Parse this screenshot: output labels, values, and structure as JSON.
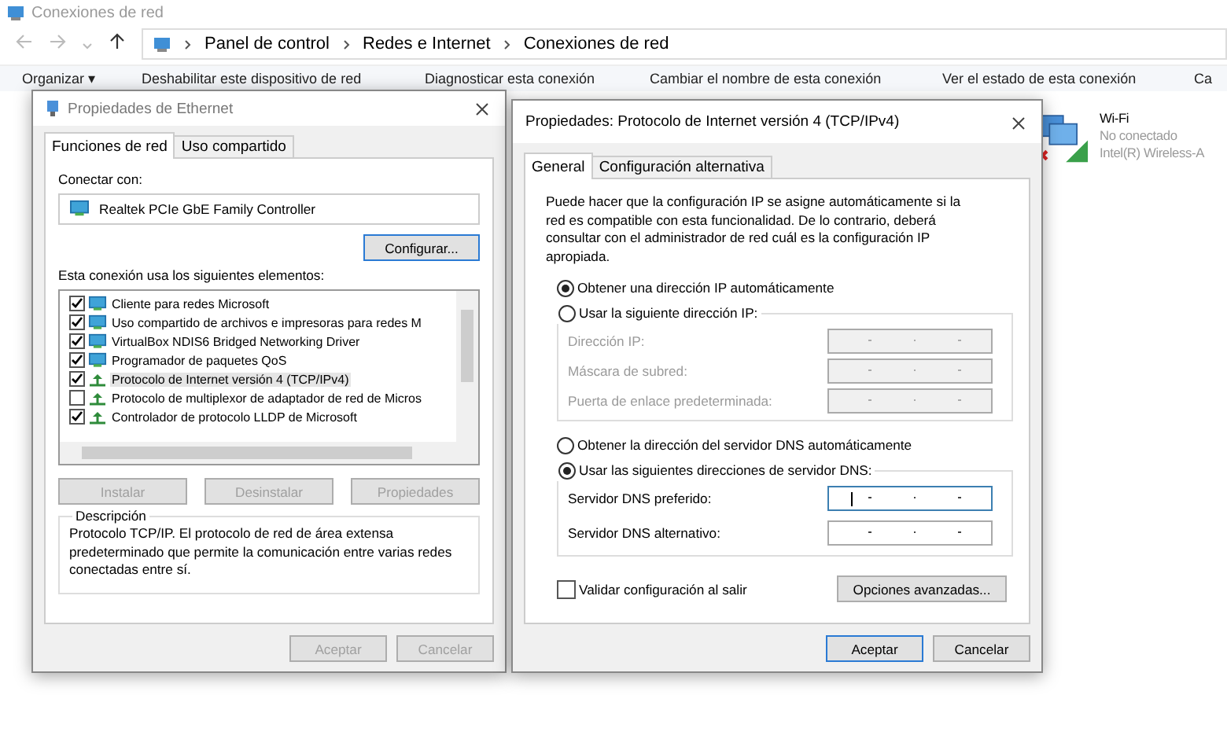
{
  "explorer": {
    "title": "Conexiones de red",
    "breadcrumbs": [
      "Panel de control",
      "Redes e Internet",
      "Conexiones de red"
    ],
    "toolbar": [
      "Organizar ▾",
      "Deshabilitar este dispositivo de red",
      "Diagnosticar esta conexión",
      "Cambiar el nombre de esta conexión",
      "Ver el estado de esta conexión",
      "Ca"
    ],
    "connection": {
      "name": "Wi-Fi",
      "status": "No conectado",
      "adapter": "Intel(R) Wireless-A"
    }
  },
  "ethernet_dialog": {
    "title": "Propiedades de Ethernet",
    "tabs": [
      {
        "label": "Funciones de red",
        "selected": true
      },
      {
        "label": "Uso compartido",
        "selected": false
      }
    ],
    "connect_label": "Conectar con:",
    "adapter": "Realtek PCIe GbE Family Controller",
    "configure_button": "Configurar...",
    "items_label": "Esta conexión usa los siguientes elementos:",
    "items": [
      {
        "label": "Cliente para redes Microsoft",
        "kind": "client",
        "checked": true,
        "selected": false
      },
      {
        "label": "Uso compartido de archivos e impresoras para redes M",
        "kind": "client",
        "checked": true,
        "selected": false
      },
      {
        "label": "VirtualBox NDIS6 Bridged Networking Driver",
        "kind": "client",
        "checked": true,
        "selected": false
      },
      {
        "label": "Programador de paquetes QoS",
        "kind": "client",
        "checked": true,
        "selected": false
      },
      {
        "label": "Protocolo de Internet versión 4 (TCP/IPv4)",
        "kind": "protocol",
        "checked": true,
        "selected": true
      },
      {
        "label": "Protocolo de multiplexor de adaptador de red de Micros",
        "kind": "protocol",
        "checked": false,
        "selected": false
      },
      {
        "label": "Controlador de protocolo LLDP de Microsoft",
        "kind": "protocol",
        "checked": true,
        "selected": false
      }
    ],
    "item_buttons": [
      {
        "label": "Instalar",
        "disabled": true
      },
      {
        "label": "Desinstalar",
        "disabled": true
      },
      {
        "label": "Propiedades",
        "disabled": true
      }
    ],
    "description_title": "Descripción",
    "description": "Protocolo TCP/IP. El protocolo de red de área extensa predeterminado que permite la comunicación entre varias redes conectadas entre sí.",
    "buttons": [
      {
        "label": "Aceptar",
        "disabled": true
      },
      {
        "label": "Cancelar",
        "disabled": true
      }
    ]
  },
  "ipv4_dialog": {
    "title": "Propiedades: Protocolo de Internet versión 4 (TCP/IPv4)",
    "tabs": [
      {
        "label": "General",
        "selected": true
      },
      {
        "label": "Configuración alternativa",
        "selected": false
      }
    ],
    "intro": "Puede hacer que la configuración IP se asigne automáticamente si la red es compatible con esta funcionalidad. De lo contrario, deberá consultar con el administrador de red cuál es la configuración IP apropiada.",
    "ip_options": [
      {
        "label": "Obtener una dirección IP automáticamente",
        "selected": true
      },
      {
        "label": "Usar la siguiente dirección IP:",
        "selected": false
      }
    ],
    "ip_fields": [
      {
        "label": "Dirección IP:",
        "disabled": true
      },
      {
        "label": "Máscara de subred:",
        "disabled": true
      },
      {
        "label": "Puerta de enlace predeterminada:",
        "disabled": true
      }
    ],
    "dns_options": [
      {
        "label": "Obtener la dirección del servidor DNS automáticamente",
        "selected": false
      },
      {
        "label": "Usar las siguientes direcciones de servidor DNS:",
        "selected": true
      }
    ],
    "dns_fields": [
      {
        "label": "Servidor DNS preferido:",
        "disabled": false,
        "focused": true
      },
      {
        "label": "Servidor DNS alternativo:",
        "disabled": false,
        "focused": false
      }
    ],
    "validate": {
      "label": "Validar configuración al salir",
      "checked": false
    },
    "advanced_button": "Opciones avanzadas...",
    "buttons": [
      {
        "label": "Aceptar",
        "default": true
      },
      {
        "label": "Cancelar",
        "default": false
      }
    ]
  }
}
